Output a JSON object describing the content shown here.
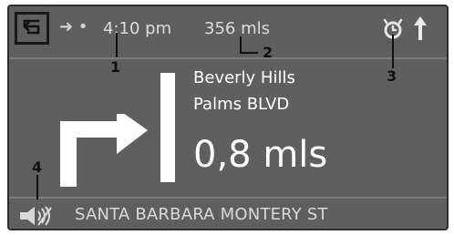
{
  "topbar": {
    "back_icon": "back-arrow-icon",
    "route_icon": "arrow-dot-icon",
    "time": "4:10 pm",
    "distance": "356  mls",
    "alarm_icon": "alarm-clock-icon",
    "north_icon": "north-arrow-icon"
  },
  "guidance": {
    "street_line1": "Beverly Hills",
    "street_line2": "Palms BLVD",
    "distance_to_turn": "0,8 mls",
    "turn_icon": "turn-right-arrow-icon"
  },
  "bottom": {
    "speaker_icon": "muted-speaker-icon",
    "current_street": "SANTA BARBARA MONTERY ST"
  },
  "callouts": {
    "c1": "1",
    "c2": "2",
    "c3": "3",
    "c4": "4"
  },
  "colors": {
    "screen_bg": "#5f5f5f",
    "text_primary": "#ffffff",
    "text_secondary": "#dcdcdc"
  }
}
